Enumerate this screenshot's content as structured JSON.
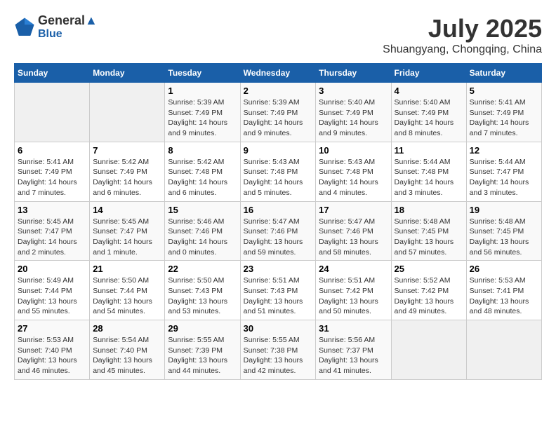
{
  "header": {
    "logo_line1": "General",
    "logo_line2": "Blue",
    "month_title": "July 2025",
    "location": "Shuangyang, Chongqing, China"
  },
  "weekdays": [
    "Sunday",
    "Monday",
    "Tuesday",
    "Wednesday",
    "Thursday",
    "Friday",
    "Saturday"
  ],
  "weeks": [
    [
      {
        "day": "",
        "info": ""
      },
      {
        "day": "",
        "info": ""
      },
      {
        "day": "1",
        "info": "Sunrise: 5:39 AM\nSunset: 7:49 PM\nDaylight: 14 hours and 9 minutes."
      },
      {
        "day": "2",
        "info": "Sunrise: 5:39 AM\nSunset: 7:49 PM\nDaylight: 14 hours and 9 minutes."
      },
      {
        "day": "3",
        "info": "Sunrise: 5:40 AM\nSunset: 7:49 PM\nDaylight: 14 hours and 9 minutes."
      },
      {
        "day": "4",
        "info": "Sunrise: 5:40 AM\nSunset: 7:49 PM\nDaylight: 14 hours and 8 minutes."
      },
      {
        "day": "5",
        "info": "Sunrise: 5:41 AM\nSunset: 7:49 PM\nDaylight: 14 hours and 7 minutes."
      }
    ],
    [
      {
        "day": "6",
        "info": "Sunrise: 5:41 AM\nSunset: 7:49 PM\nDaylight: 14 hours and 7 minutes."
      },
      {
        "day": "7",
        "info": "Sunrise: 5:42 AM\nSunset: 7:49 PM\nDaylight: 14 hours and 6 minutes."
      },
      {
        "day": "8",
        "info": "Sunrise: 5:42 AM\nSunset: 7:48 PM\nDaylight: 14 hours and 6 minutes."
      },
      {
        "day": "9",
        "info": "Sunrise: 5:43 AM\nSunset: 7:48 PM\nDaylight: 14 hours and 5 minutes."
      },
      {
        "day": "10",
        "info": "Sunrise: 5:43 AM\nSunset: 7:48 PM\nDaylight: 14 hours and 4 minutes."
      },
      {
        "day": "11",
        "info": "Sunrise: 5:44 AM\nSunset: 7:48 PM\nDaylight: 14 hours and 3 minutes."
      },
      {
        "day": "12",
        "info": "Sunrise: 5:44 AM\nSunset: 7:47 PM\nDaylight: 14 hours and 3 minutes."
      }
    ],
    [
      {
        "day": "13",
        "info": "Sunrise: 5:45 AM\nSunset: 7:47 PM\nDaylight: 14 hours and 2 minutes."
      },
      {
        "day": "14",
        "info": "Sunrise: 5:45 AM\nSunset: 7:47 PM\nDaylight: 14 hours and 1 minute."
      },
      {
        "day": "15",
        "info": "Sunrise: 5:46 AM\nSunset: 7:46 PM\nDaylight: 14 hours and 0 minutes."
      },
      {
        "day": "16",
        "info": "Sunrise: 5:47 AM\nSunset: 7:46 PM\nDaylight: 13 hours and 59 minutes."
      },
      {
        "day": "17",
        "info": "Sunrise: 5:47 AM\nSunset: 7:46 PM\nDaylight: 13 hours and 58 minutes."
      },
      {
        "day": "18",
        "info": "Sunrise: 5:48 AM\nSunset: 7:45 PM\nDaylight: 13 hours and 57 minutes."
      },
      {
        "day": "19",
        "info": "Sunrise: 5:48 AM\nSunset: 7:45 PM\nDaylight: 13 hours and 56 minutes."
      }
    ],
    [
      {
        "day": "20",
        "info": "Sunrise: 5:49 AM\nSunset: 7:44 PM\nDaylight: 13 hours and 55 minutes."
      },
      {
        "day": "21",
        "info": "Sunrise: 5:50 AM\nSunset: 7:44 PM\nDaylight: 13 hours and 54 minutes."
      },
      {
        "day": "22",
        "info": "Sunrise: 5:50 AM\nSunset: 7:43 PM\nDaylight: 13 hours and 53 minutes."
      },
      {
        "day": "23",
        "info": "Sunrise: 5:51 AM\nSunset: 7:43 PM\nDaylight: 13 hours and 51 minutes."
      },
      {
        "day": "24",
        "info": "Sunrise: 5:51 AM\nSunset: 7:42 PM\nDaylight: 13 hours and 50 minutes."
      },
      {
        "day": "25",
        "info": "Sunrise: 5:52 AM\nSunset: 7:42 PM\nDaylight: 13 hours and 49 minutes."
      },
      {
        "day": "26",
        "info": "Sunrise: 5:53 AM\nSunset: 7:41 PM\nDaylight: 13 hours and 48 minutes."
      }
    ],
    [
      {
        "day": "27",
        "info": "Sunrise: 5:53 AM\nSunset: 7:40 PM\nDaylight: 13 hours and 46 minutes."
      },
      {
        "day": "28",
        "info": "Sunrise: 5:54 AM\nSunset: 7:40 PM\nDaylight: 13 hours and 45 minutes."
      },
      {
        "day": "29",
        "info": "Sunrise: 5:55 AM\nSunset: 7:39 PM\nDaylight: 13 hours and 44 minutes."
      },
      {
        "day": "30",
        "info": "Sunrise: 5:55 AM\nSunset: 7:38 PM\nDaylight: 13 hours and 42 minutes."
      },
      {
        "day": "31",
        "info": "Sunrise: 5:56 AM\nSunset: 7:37 PM\nDaylight: 13 hours and 41 minutes."
      },
      {
        "day": "",
        "info": ""
      },
      {
        "day": "",
        "info": ""
      }
    ]
  ]
}
